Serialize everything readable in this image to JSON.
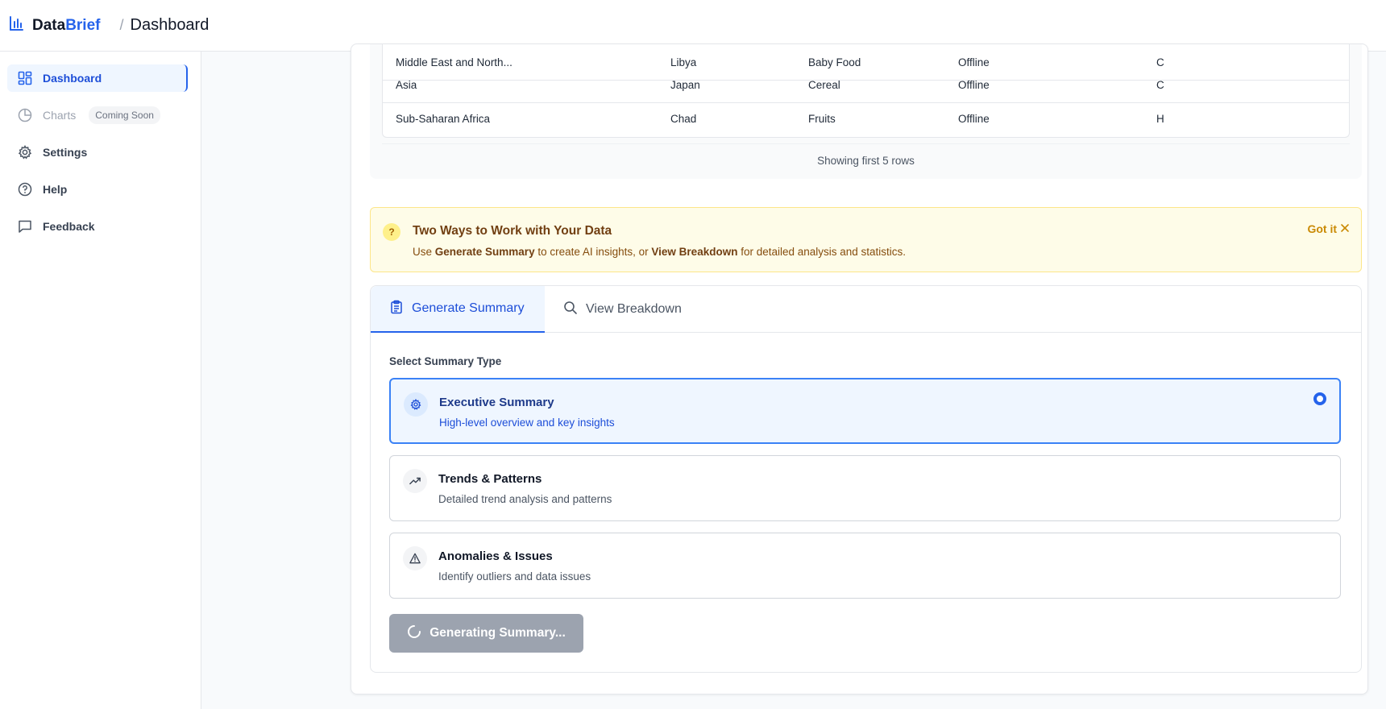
{
  "header": {
    "brand_part1": "Data",
    "brand_part2": "Brief",
    "separator": "/",
    "page_title": "Dashboard"
  },
  "sidebar": {
    "items": [
      {
        "label": "Dashboard",
        "icon": "grid-icon",
        "active": true
      },
      {
        "label": "Charts",
        "icon": "pie-chart-icon",
        "badge": "Coming Soon",
        "disabled": true
      },
      {
        "label": "Settings",
        "icon": "gear-icon"
      },
      {
        "label": "Help",
        "icon": "help-circle-icon"
      },
      {
        "label": "Feedback",
        "icon": "message-icon"
      }
    ]
  },
  "preview": {
    "rows": [
      [
        "Middle East and North...",
        "Libya",
        "Baby Food",
        "Offline",
        "C"
      ],
      [
        "Asia",
        "Japan",
        "Cereal",
        "Offline",
        "C"
      ],
      [
        "Sub-Saharan Africa",
        "Chad",
        "Fruits",
        "Offline",
        "H"
      ]
    ],
    "footer": "Showing first 5 rows"
  },
  "banner": {
    "icon_text": "?",
    "title": "Two Ways to Work with Your Data",
    "desc_1": "Use ",
    "desc_b1": "Generate Summary",
    "desc_2": " to create AI insights, or ",
    "desc_b2": "View Breakdown",
    "desc_3": " for detailed analysis and statistics.",
    "dismiss": "Got it"
  },
  "tabs": {
    "generate": "Generate Summary",
    "breakdown": "View Breakdown"
  },
  "summary": {
    "select_label": "Select Summary Type",
    "options": [
      {
        "title": "Executive Summary",
        "desc": "High-level overview and key insights",
        "icon": "gear-icon",
        "selected": true
      },
      {
        "title": "Trends & Patterns",
        "desc": "Detailed trend analysis and patterns",
        "icon": "trending-up-icon"
      },
      {
        "title": "Anomalies & Issues",
        "desc": "Identify outliers and data issues",
        "icon": "warning-icon"
      }
    ],
    "button_label": "Generating Summary..."
  },
  "colors": {
    "accent": "#2563eb",
    "banner_bg": "#fefce8",
    "button_disabled": "#9ca3af"
  }
}
